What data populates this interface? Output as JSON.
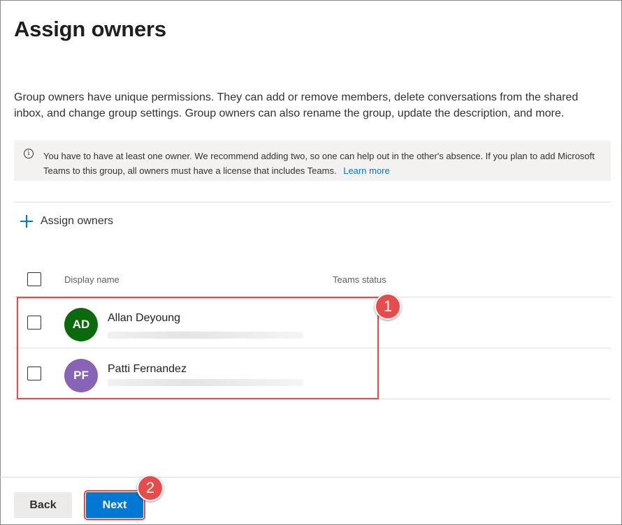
{
  "page": {
    "title": "Assign owners",
    "description": "Group owners have unique permissions. They can add or remove members, delete conversations from the shared inbox, and change group settings. Group owners can also rename the group, update the description, and more."
  },
  "info_bar": {
    "icon": "info-icon",
    "text": "You have to have at least one owner. We recommend adding two, so one can help out in the other's absence. If you plan to add Microsoft Teams to this group, all owners must have a license that includes Teams.",
    "link_label": "Learn more"
  },
  "assign_button": {
    "icon": "plus-icon",
    "label": "Assign owners"
  },
  "table": {
    "columns": [
      "Display name",
      "Teams status"
    ],
    "rows": [
      {
        "initials": "AD",
        "name": "Allan Deyoung",
        "avatar_color": "#0b6a0b"
      },
      {
        "initials": "PF",
        "name": "Patti Fernandez",
        "avatar_color": "#8764b8"
      }
    ]
  },
  "annotations": {
    "marker_1": "1",
    "marker_2": "2",
    "color": "#e74c4c"
  },
  "footer": {
    "back_label": "Back",
    "next_label": "Next"
  },
  "colors": {
    "accent": "#0078d4",
    "info_bg": "#f3f2f1"
  }
}
